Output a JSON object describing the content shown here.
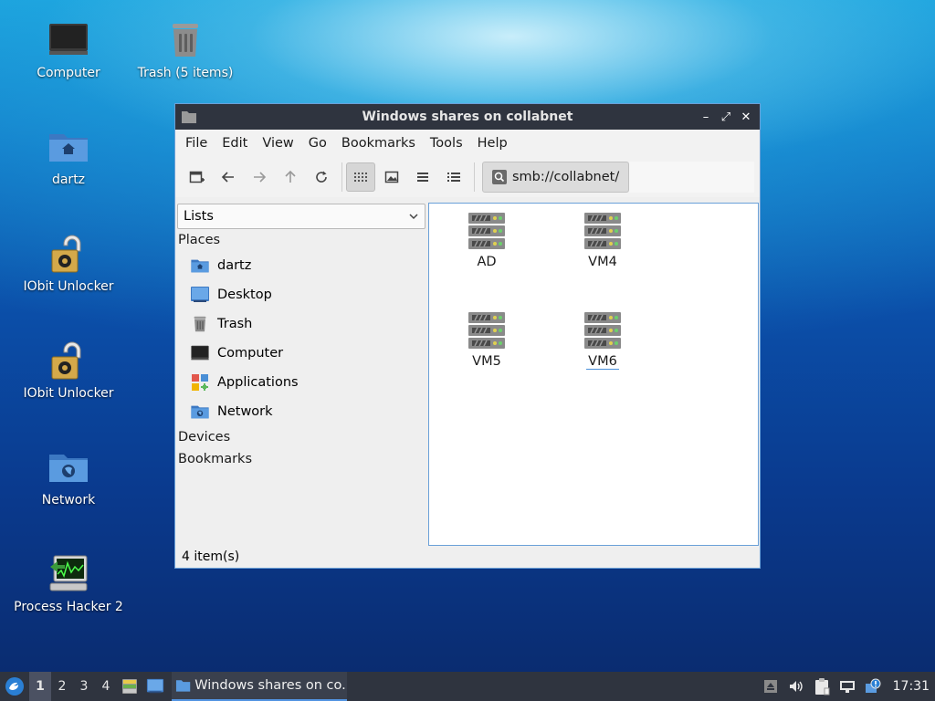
{
  "desktop": {
    "icons": [
      {
        "label": "Computer",
        "icon": "monitor-icon"
      },
      {
        "label": "Trash (5 items)",
        "icon": "trash-icon"
      },
      {
        "label": "dartz",
        "icon": "home-folder-icon"
      },
      {
        "label": "IObit Unlocker",
        "icon": "padlock-icon"
      },
      {
        "label": "IObit Unlocker",
        "icon": "padlock-icon"
      },
      {
        "label": "Network",
        "icon": "network-folder-icon"
      },
      {
        "label": "Process Hacker 2",
        "icon": "process-monitor-icon"
      }
    ]
  },
  "window": {
    "title": "Windows shares on collabnet",
    "controls": {
      "minimize": "–",
      "maximize": "⤢",
      "close": "✕"
    },
    "menu": [
      "File",
      "Edit",
      "View",
      "Go",
      "Bookmarks",
      "Tools",
      "Help"
    ],
    "toolbar": {
      "location": "smb://collabnet/",
      "view_mode_active": "icon-view"
    },
    "sidepane": {
      "mode": "Lists",
      "places_heading": "Places",
      "places": [
        {
          "label": "dartz",
          "icon": "home-folder-icon"
        },
        {
          "label": "Desktop",
          "icon": "desktop-icon"
        },
        {
          "label": "Trash",
          "icon": "trash-icon"
        },
        {
          "label": "Computer",
          "icon": "monitor-icon"
        },
        {
          "label": "Applications",
          "icon": "applications-icon"
        },
        {
          "label": "Network",
          "icon": "network-folder-icon"
        }
      ],
      "devices_heading": "Devices",
      "bookmarks_heading": "Bookmarks"
    },
    "files": [
      {
        "label": "AD",
        "icon": "server-icon"
      },
      {
        "label": "VM4",
        "icon": "server-icon"
      },
      {
        "label": "VM5",
        "icon": "server-icon"
      },
      {
        "label": "VM6",
        "icon": "server-icon"
      }
    ],
    "status": "4 item(s)"
  },
  "taskbar": {
    "workspaces": [
      "1",
      "2",
      "3",
      "4"
    ],
    "active_workspace": "1",
    "task_label": "Windows shares on co...",
    "clock": "17:31"
  },
  "colors": {
    "titlebar": "#2f343f",
    "accent": "#5294e2",
    "folder_blue": "#4a8fd6"
  }
}
